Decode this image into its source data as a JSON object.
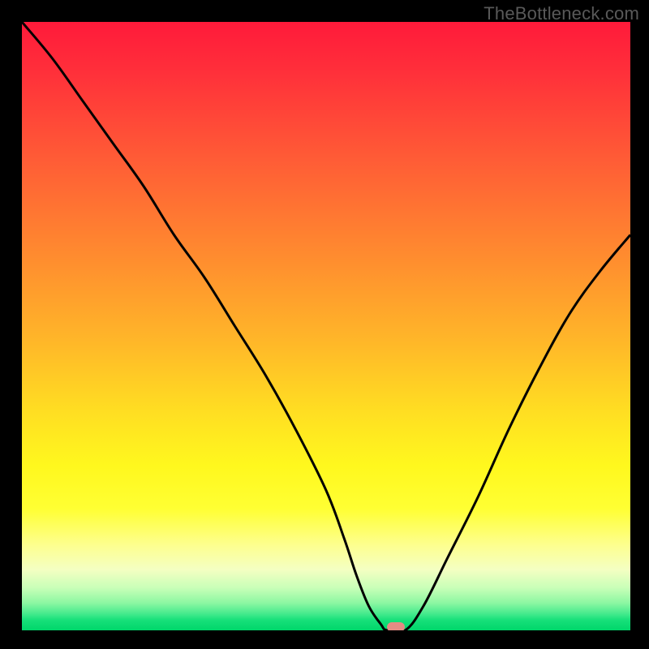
{
  "watermark": "TheBottleneck.com",
  "chart_data": {
    "type": "line",
    "title": "",
    "xlabel": "",
    "ylabel": "",
    "xlim": [
      0,
      100
    ],
    "ylim": [
      0,
      100
    ],
    "grid": false,
    "series": [
      {
        "name": "bottleneck-curve",
        "x": [
          0,
          5,
          10,
          15,
          20,
          25,
          30,
          35,
          40,
          45,
          50,
          53,
          55,
          57,
          59,
          60,
          63,
          66,
          70,
          75,
          80,
          85,
          90,
          95,
          100
        ],
        "y": [
          100,
          94,
          87,
          80,
          73,
          65,
          58,
          50,
          42,
          33,
          23,
          15,
          9,
          4,
          1,
          0,
          0,
          4,
          12,
          22,
          33,
          43,
          52,
          59,
          65
        ]
      }
    ],
    "marker": {
      "x": 61.5,
      "y": 0.5,
      "color": "#e48b84"
    },
    "gradient_stops": [
      {
        "pos": 0,
        "color": "#ff1a3a"
      },
      {
        "pos": 50,
        "color": "#ffb529"
      },
      {
        "pos": 75,
        "color": "#fff81e"
      },
      {
        "pos": 100,
        "color": "#00d66a"
      }
    ]
  },
  "plot": {
    "inner_left": 27,
    "inner_top": 27,
    "inner_width": 750,
    "inner_height": 750
  }
}
